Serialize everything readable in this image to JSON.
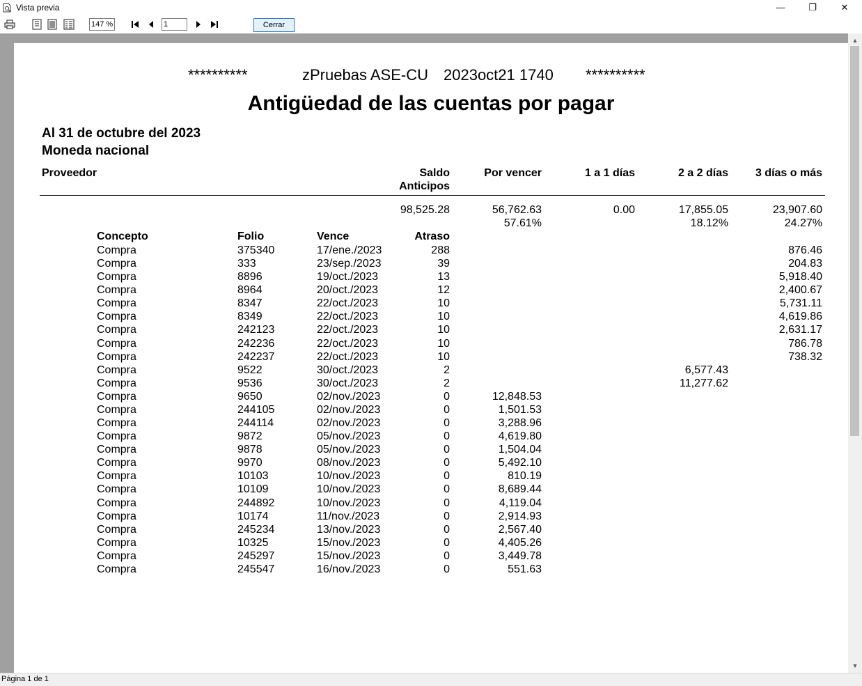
{
  "window": {
    "title": "Vista previa",
    "minimize": "—",
    "restore": "❐",
    "close": "✕"
  },
  "toolbar": {
    "zoom": "147 %",
    "page_input": "1",
    "close_label": "Cerrar"
  },
  "status": {
    "page_text": "Página 1 de 1"
  },
  "report": {
    "stars_left": "**********",
    "company": "zPruebas ASE-CU",
    "stamp": "2023oct21 1740",
    "stars_right": "**********",
    "title": "Antigüedad de las cuentas por pagar",
    "as_of": "Al 31 de octubre del 2023",
    "currency": "Moneda nacional",
    "headers": {
      "proveedor": "Proveedor",
      "saldo": "Saldo",
      "anticipos": "Anticipos",
      "por_vencer": "Por vencer",
      "b1": "1 a 1 días",
      "b2": "2 a 2 días",
      "b3": "3 días o más"
    },
    "totals": {
      "saldo": "98,525.28",
      "por_vencer": "56,762.63",
      "b1": "0.00",
      "b2": "17,855.05",
      "b3": "23,907.60"
    },
    "percents": {
      "por_vencer": "57.61%",
      "b2": "18.12%",
      "b3": "24.27%"
    },
    "detail_headers": {
      "concepto": "Concepto",
      "folio": "Folio",
      "vence": "Vence",
      "atraso": "Atraso"
    },
    "rows": [
      {
        "concepto": "Compra",
        "folio": "375340",
        "vence": "17/ene./2023",
        "atraso": "288",
        "por_vencer": "",
        "b2": "",
        "b3": "876.46"
      },
      {
        "concepto": "Compra",
        "folio": "333",
        "vence": "23/sep./2023",
        "atraso": "39",
        "por_vencer": "",
        "b2": "",
        "b3": "204.83"
      },
      {
        "concepto": "Compra",
        "folio": "8896",
        "vence": "19/oct./2023",
        "atraso": "13",
        "por_vencer": "",
        "b2": "",
        "b3": "5,918.40"
      },
      {
        "concepto": "Compra",
        "folio": "8964",
        "vence": "20/oct./2023",
        "atraso": "12",
        "por_vencer": "",
        "b2": "",
        "b3": "2,400.67"
      },
      {
        "concepto": "Compra",
        "folio": "8347",
        "vence": "22/oct./2023",
        "atraso": "10",
        "por_vencer": "",
        "b2": "",
        "b3": "5,731.11"
      },
      {
        "concepto": "Compra",
        "folio": "8349",
        "vence": "22/oct./2023",
        "atraso": "10",
        "por_vencer": "",
        "b2": "",
        "b3": "4,619.86"
      },
      {
        "concepto": "Compra",
        "folio": "242123",
        "vence": "22/oct./2023",
        "atraso": "10",
        "por_vencer": "",
        "b2": "",
        "b3": "2,631.17"
      },
      {
        "concepto": "Compra",
        "folio": "242236",
        "vence": "22/oct./2023",
        "atraso": "10",
        "por_vencer": "",
        "b2": "",
        "b3": "786.78"
      },
      {
        "concepto": "Compra",
        "folio": "242237",
        "vence": "22/oct./2023",
        "atraso": "10",
        "por_vencer": "",
        "b2": "",
        "b3": "738.32"
      },
      {
        "concepto": "Compra",
        "folio": "9522",
        "vence": "30/oct./2023",
        "atraso": "2",
        "por_vencer": "",
        "b2": "6,577.43",
        "b3": ""
      },
      {
        "concepto": "Compra",
        "folio": "9536",
        "vence": "30/oct./2023",
        "atraso": "2",
        "por_vencer": "",
        "b2": "11,277.62",
        "b3": ""
      },
      {
        "concepto": "Compra",
        "folio": "9650",
        "vence": "02/nov./2023",
        "atraso": "0",
        "por_vencer": "12,848.53",
        "b2": "",
        "b3": ""
      },
      {
        "concepto": "Compra",
        "folio": "244105",
        "vence": "02/nov./2023",
        "atraso": "0",
        "por_vencer": "1,501.53",
        "b2": "",
        "b3": ""
      },
      {
        "concepto": "Compra",
        "folio": "244114",
        "vence": "02/nov./2023",
        "atraso": "0",
        "por_vencer": "3,288.96",
        "b2": "",
        "b3": ""
      },
      {
        "concepto": "Compra",
        "folio": "9872",
        "vence": "05/nov./2023",
        "atraso": "0",
        "por_vencer": "4,619.80",
        "b2": "",
        "b3": ""
      },
      {
        "concepto": "Compra",
        "folio": "9878",
        "vence": "05/nov./2023",
        "atraso": "0",
        "por_vencer": "1,504.04",
        "b2": "",
        "b3": ""
      },
      {
        "concepto": "Compra",
        "folio": "9970",
        "vence": "08/nov./2023",
        "atraso": "0",
        "por_vencer": "5,492.10",
        "b2": "",
        "b3": ""
      },
      {
        "concepto": "Compra",
        "folio": "10103",
        "vence": "10/nov./2023",
        "atraso": "0",
        "por_vencer": "810.19",
        "b2": "",
        "b3": ""
      },
      {
        "concepto": "Compra",
        "folio": "10109",
        "vence": "10/nov./2023",
        "atraso": "0",
        "por_vencer": "8,689.44",
        "b2": "",
        "b3": ""
      },
      {
        "concepto": "Compra",
        "folio": "244892",
        "vence": "10/nov./2023",
        "atraso": "0",
        "por_vencer": "4,119.04",
        "b2": "",
        "b3": ""
      },
      {
        "concepto": "Compra",
        "folio": "10174",
        "vence": "11/nov./2023",
        "atraso": "0",
        "por_vencer": "2,914.93",
        "b2": "",
        "b3": ""
      },
      {
        "concepto": "Compra",
        "folio": "245234",
        "vence": "13/nov./2023",
        "atraso": "0",
        "por_vencer": "2,567.40",
        "b2": "",
        "b3": ""
      },
      {
        "concepto": "Compra",
        "folio": "10325",
        "vence": "15/nov./2023",
        "atraso": "0",
        "por_vencer": "4,405.26",
        "b2": "",
        "b3": ""
      },
      {
        "concepto": "Compra",
        "folio": "245297",
        "vence": "15/nov./2023",
        "atraso": "0",
        "por_vencer": "3,449.78",
        "b2": "",
        "b3": ""
      },
      {
        "concepto": "Compra",
        "folio": "245547",
        "vence": "16/nov./2023",
        "atraso": "0",
        "por_vencer": "551.63",
        "b2": "",
        "b3": ""
      }
    ]
  }
}
